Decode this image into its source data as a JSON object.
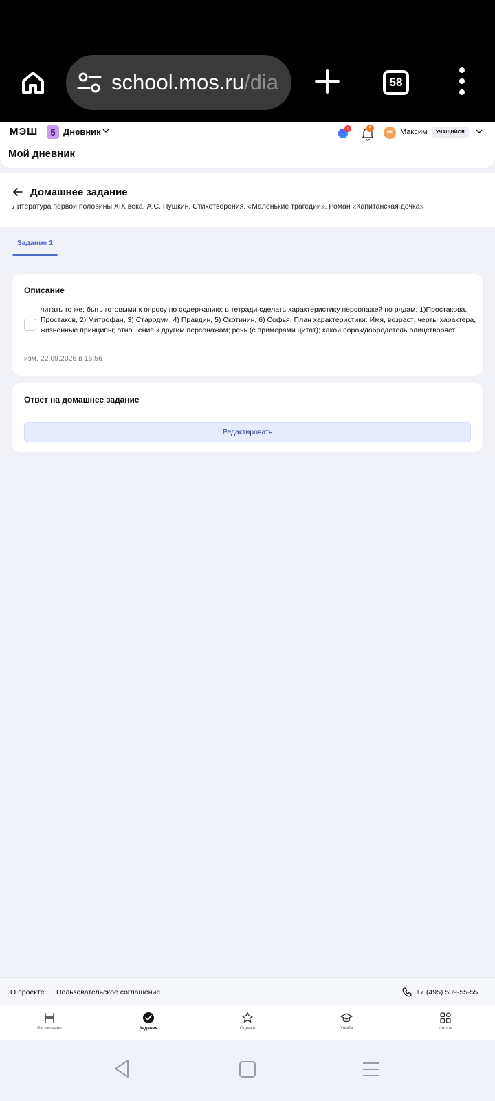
{
  "browser": {
    "url_main": "school.mos.ru",
    "url_rest": "/dia",
    "tab_count": "58",
    "icons": [
      "home-icon",
      "site-settings-icon",
      "new-tab-plus-icon",
      "tabs-counter-icon",
      "more-vertical-icon"
    ]
  },
  "header": {
    "logo": "МЭШ",
    "app_badge": "5",
    "app_name": "Дневник",
    "assistant_badge": "!",
    "notifications_count": "9",
    "avatar_initials": "МК",
    "user_name": "Максим",
    "role": "УЧАЩИЙСЯ",
    "page_title": "Мой дневник"
  },
  "homework": {
    "title": "Домашнее задание",
    "subject": "Литература первой половины XIX века. А.С. Пушкин. Стихотворения. «Маленькие трагедии». Роман «Капитанская дочка»",
    "tabs": [
      {
        "label": "Задание 1",
        "active": true
      }
    ]
  },
  "description": {
    "title": "Описание",
    "text": "читать то же; быть готовыми к опросу по содержанию; в тетради сделать характеристику персонажей по рядам: 1)Простакова, Простаков, 2) Митрофан, 3) Стародум, 4) Правдин, 5) Скотинин, 6) Софья. План характеристики: Имя, возраст; черты характера, жизненные принципы; отношение к другим персонажам; речь (с примерами цитат); какой порок/добродетель олицетворяет",
    "checked": false,
    "edited": "изм. 22.09.2026 в 16:56"
  },
  "answer": {
    "title": "Ответ на домашнее задание",
    "edit_button": "Редактировать"
  },
  "footer": {
    "about": "О проекте",
    "agreement": "Пользовательское соглашение",
    "phone": "+7 (495) 539-55-55"
  },
  "bottom_nav": [
    {
      "label": "Расписание",
      "icon": "schedule-icon",
      "active": false
    },
    {
      "label": "Задания",
      "icon": "tasks-check-icon",
      "active": true
    },
    {
      "label": "Оценки",
      "icon": "star-icon",
      "active": false
    },
    {
      "label": "Учёба",
      "icon": "graduation-cap-icon",
      "active": false
    },
    {
      "label": "Школа",
      "icon": "grid-apps-icon",
      "active": false
    }
  ],
  "colors": {
    "accent": "#4f6ec7",
    "button_bg": "#e6ecfd",
    "page_bg": "#f1f2f7",
    "notification_badge": "#ee7a1e",
    "alert_badge": "#ef3b3b"
  }
}
